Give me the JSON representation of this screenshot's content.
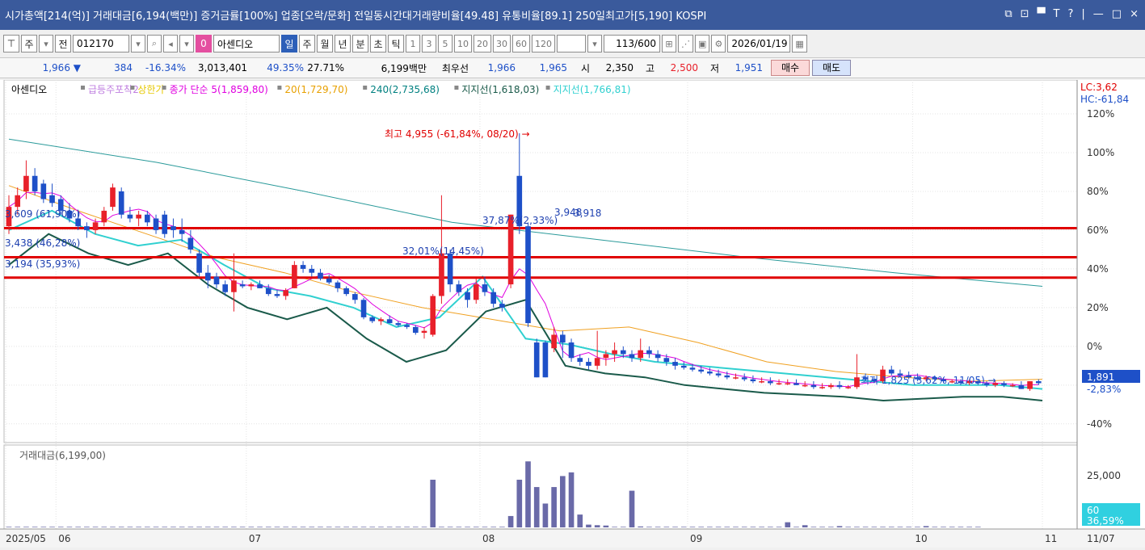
{
  "titlebar": {
    "text": "시가총액[214(억)] 거래대금[6,194(백만)] 증거금률[100%] 업종[오락/문화] 전일동시간대거래량비율[49.48] 유통비율[89.1] 250일최고가[5,190] KOSPI",
    "controls": [
      "⧉",
      "⊡",
      "▀",
      "T",
      "?",
      "|",
      "—",
      "□",
      "×"
    ]
  },
  "toolbar": {
    "first_btn": "⊤",
    "ju_btn": "주",
    "jeon_btn": "전",
    "code": "012170",
    "zero_btn": "0",
    "stock_name": "아센디오",
    "periods": [
      "일",
      "주",
      "월",
      "년",
      "분",
      "초",
      "틱"
    ],
    "active_period": "일",
    "intervals": [
      "1",
      "3",
      "5",
      "10",
      "20",
      "30",
      "60",
      "120"
    ],
    "count": "113",
    "count_total": "/600",
    "date": "2026/01/19"
  },
  "quote": {
    "price": "1,966 ▼",
    "change": "384",
    "change_pct": "-16.34%",
    "volume": "3,013,401",
    "vol_ratio": "49.35%",
    "turnover": "27.71%",
    "amount": "6,199백만",
    "best_ask_label": "최우선",
    "ask": "1,966",
    "bid": "1,965",
    "open_label": "시",
    "open": "2,350",
    "high_label": "고",
    "high": "2,500",
    "low_label": "저",
    "low": "1,951",
    "buy_label": "매수",
    "sell_label": "매도"
  },
  "legend": {
    "stock": "아센디오",
    "items": [
      {
        "text": "급등주포착2",
        "color": "#c080e0"
      },
      {
        "text": "상한가",
        "color": "#e6c800"
      },
      {
        "text": "종가 단순 5(1,859,80)",
        "color": "#e000e0"
      },
      {
        "text": "20(1,729,70)",
        "color": "#e8a000"
      },
      {
        "text": "240(2,735,68)",
        "color": "#008080"
      },
      {
        "text": "지지선(1,618,03)",
        "color": "#1a5a4a"
      },
      {
        "text": "지지선(1,766,81)",
        "color": "#30d0d0"
      }
    ]
  },
  "price_axis": {
    "lc": "LC:3,62",
    "hc": "HC:-61,84",
    "current_price": "1,891",
    "current_pct": "-2,83%"
  },
  "annotations": {
    "high_marker": "최고 4,955 (-61,84%, 08/20) →",
    "low_marker": "최저 1,825 (3,62%, 11/05) →",
    "level1": "3,609 (61,90%)",
    "level2": "3,438 (46,28%)",
    "level3": "3,194 (35,93%)",
    "trend1": "32,01%(14,45%)",
    "trend2": "37,87%(2,33%)",
    "trend3": "3,948",
    "trend4": "3,918"
  },
  "volume_panel": {
    "title": "거래대금(6,199,00)",
    "axis_label": "25,000",
    "badge_value": "60",
    "badge_pct": "36,59%"
  },
  "colors": {
    "up": "#e8202a",
    "down": "#1e50c8",
    "resistance": "#e00000",
    "title_bg": "#3a5a9c"
  },
  "chart_data": [
    {
      "type": "candlestick",
      "x_ticks": [
        "2025/05",
        "06",
        "07",
        "08",
        "09",
        "10",
        "11",
        "11/07"
      ],
      "y_ticks_pct": [
        120,
        100,
        80,
        60,
        40,
        20,
        0,
        -20,
        -40
      ],
      "y_tick_labels": [
        "120%",
        "100%",
        "80%",
        "60%",
        "40%",
        "20%",
        "0%",
        "",
        "-40%"
      ],
      "ylim_pct": [
        -48,
        125
      ],
      "candles": [
        {
          "o": 62,
          "h": 78,
          "l": 58,
          "c": 72
        },
        {
          "o": 72,
          "h": 82,
          "l": 68,
          "c": 78
        },
        {
          "o": 80,
          "h": 96,
          "l": 76,
          "c": 88
        },
        {
          "o": 88,
          "h": 92,
          "l": 78,
          "c": 80
        },
        {
          "o": 84,
          "h": 86,
          "l": 74,
          "c": 76
        },
        {
          "o": 78,
          "h": 84,
          "l": 72,
          "c": 74
        },
        {
          "o": 76,
          "h": 78,
          "l": 68,
          "c": 70
        },
        {
          "o": 70,
          "h": 74,
          "l": 64,
          "c": 66
        },
        {
          "o": 66,
          "h": 70,
          "l": 60,
          "c": 62
        },
        {
          "o": 62,
          "h": 64,
          "l": 56,
          "c": 60
        },
        {
          "o": 60,
          "h": 66,
          "l": 58,
          "c": 64
        },
        {
          "o": 64,
          "h": 72,
          "l": 62,
          "c": 70
        },
        {
          "o": 72,
          "h": 84,
          "l": 70,
          "c": 82
        },
        {
          "o": 80,
          "h": 82,
          "l": 66,
          "c": 68
        },
        {
          "o": 68,
          "h": 72,
          "l": 64,
          "c": 66
        },
        {
          "o": 66,
          "h": 70,
          "l": 62,
          "c": 68
        },
        {
          "o": 68,
          "h": 70,
          "l": 62,
          "c": 64
        },
        {
          "o": 66,
          "h": 68,
          "l": 58,
          "c": 60
        },
        {
          "o": 68,
          "h": 70,
          "l": 56,
          "c": 58
        },
        {
          "o": 62,
          "h": 66,
          "l": 56,
          "c": 60
        },
        {
          "o": 60,
          "h": 66,
          "l": 54,
          "c": 58
        },
        {
          "o": 56,
          "h": 60,
          "l": 48,
          "c": 50
        },
        {
          "o": 48,
          "h": 50,
          "l": 36,
          "c": 38
        },
        {
          "o": 38,
          "h": 42,
          "l": 30,
          "c": 34
        },
        {
          "o": 36,
          "h": 38,
          "l": 30,
          "c": 32
        },
        {
          "o": 32,
          "h": 34,
          "l": 26,
          "c": 28
        },
        {
          "o": 28,
          "h": 48,
          "l": 18,
          "c": 34
        },
        {
          "o": 32,
          "h": 34,
          "l": 30,
          "c": 31
        },
        {
          "o": 31,
          "h": 33,
          "l": 29,
          "c": 32
        },
        {
          "o": 32,
          "h": 34,
          "l": 30,
          "c": 30
        },
        {
          "o": 30,
          "h": 32,
          "l": 26,
          "c": 27
        },
        {
          "o": 27,
          "h": 29,
          "l": 25,
          "c": 26
        },
        {
          "o": 26,
          "h": 30,
          "l": 24,
          "c": 29
        },
        {
          "o": 30,
          "h": 44,
          "l": 30,
          "c": 42
        },
        {
          "o": 42,
          "h": 44,
          "l": 38,
          "c": 40
        },
        {
          "o": 40,
          "h": 42,
          "l": 36,
          "c": 38
        },
        {
          "o": 38,
          "h": 40,
          "l": 34,
          "c": 35
        },
        {
          "o": 35,
          "h": 37,
          "l": 32,
          "c": 33
        },
        {
          "o": 33,
          "h": 34,
          "l": 28,
          "c": 30
        },
        {
          "o": 30,
          "h": 31,
          "l": 26,
          "c": 27
        },
        {
          "o": 27,
          "h": 28,
          "l": 22,
          "c": 24
        },
        {
          "o": 24,
          "h": 25,
          "l": 14,
          "c": 15
        },
        {
          "o": 15,
          "h": 16,
          "l": 12,
          "c": 13
        },
        {
          "o": 13,
          "h": 15,
          "l": 11,
          "c": 14
        },
        {
          "o": 14,
          "h": 16,
          "l": 12,
          "c": 12
        },
        {
          "o": 12,
          "h": 13,
          "l": 10,
          "c": 11
        },
        {
          "o": 11,
          "h": 12,
          "l": 9,
          "c": 10
        },
        {
          "o": 10,
          "h": 11,
          "l": 6,
          "c": 7
        },
        {
          "o": 7,
          "h": 10,
          "l": 4,
          "c": 8
        },
        {
          "o": 6,
          "h": 27,
          "l": 5,
          "c": 26
        },
        {
          "o": 26,
          "h": 78,
          "l": 22,
          "c": 48
        },
        {
          "o": 48,
          "h": 50,
          "l": 28,
          "c": 32
        },
        {
          "o": 32,
          "h": 34,
          "l": 26,
          "c": 28
        },
        {
          "o": 28,
          "h": 30,
          "l": 20,
          "c": 24
        },
        {
          "o": 24,
          "h": 35,
          "l": 22,
          "c": 32
        },
        {
          "o": 32,
          "h": 36,
          "l": 26,
          "c": 28
        },
        {
          "o": 28,
          "h": 30,
          "l": 20,
          "c": 22
        },
        {
          "o": 22,
          "h": 24,
          "l": 18,
          "c": 20
        },
        {
          "o": 32,
          "h": 68,
          "l": 30,
          "c": 68
        },
        {
          "o": 88,
          "h": 110,
          "l": 58,
          "c": 62
        },
        {
          "o": 62,
          "h": 64,
          "l": 10,
          "c": 12
        },
        {
          "o": 2,
          "h": 4,
          "l": -16,
          "c": -16
        },
        {
          "o": 2,
          "h": 3,
          "l": -16,
          "c": -16
        },
        {
          "o": -1,
          "h": 10,
          "l": -3,
          "c": 6
        },
        {
          "o": 6,
          "h": 8,
          "l": -6,
          "c": 2
        },
        {
          "o": 2,
          "h": 4,
          "l": -8,
          "c": -6
        },
        {
          "o": -6,
          "h": -4,
          "l": -10,
          "c": -8
        },
        {
          "o": -8,
          "h": -6,
          "l": -12,
          "c": -10
        },
        {
          "o": -10,
          "h": 8,
          "l": -12,
          "c": -6
        },
        {
          "o": -6,
          "h": -2,
          "l": -10,
          "c": -4
        },
        {
          "o": -4,
          "h": 2,
          "l": -8,
          "c": -2
        },
        {
          "o": -2,
          "h": 0,
          "l": -6,
          "c": -4
        },
        {
          "o": -4,
          "h": -2,
          "l": -8,
          "c": -6
        },
        {
          "o": -6,
          "h": 4,
          "l": -8,
          "c": -2
        },
        {
          "o": -2,
          "h": 0,
          "l": -6,
          "c": -4
        },
        {
          "o": -4,
          "h": -2,
          "l": -8,
          "c": -6
        },
        {
          "o": -6,
          "h": -4,
          "l": -10,
          "c": -8
        },
        {
          "o": -8,
          "h": -6,
          "l": -12,
          "c": -10
        },
        {
          "o": -10,
          "h": -8,
          "l": -12,
          "c": -11
        },
        {
          "o": -11,
          "h": -9,
          "l": -13,
          "c": -12
        },
        {
          "o": -12,
          "h": -10,
          "l": -14,
          "c": -13
        },
        {
          "o": -13,
          "h": -11,
          "l": -15,
          "c": -14
        },
        {
          "o": -14,
          "h": -12,
          "l": -16,
          "c": -15
        },
        {
          "o": -15,
          "h": -13,
          "l": -17,
          "c": -16
        },
        {
          "o": -16,
          "h": -14,
          "l": -17,
          "c": -16
        },
        {
          "o": -16,
          "h": -14,
          "l": -18,
          "c": -17
        },
        {
          "o": -17,
          "h": -15,
          "l": -19,
          "c": -18
        },
        {
          "o": -18,
          "h": -16,
          "l": -19,
          "c": -18
        },
        {
          "o": -18,
          "h": -16,
          "l": -20,
          "c": -19
        },
        {
          "o": -19,
          "h": -17,
          "l": -20,
          "c": -19
        },
        {
          "o": -19,
          "h": -17,
          "l": -20,
          "c": -19
        },
        {
          "o": -19,
          "h": -17,
          "l": -20,
          "c": -20
        },
        {
          "o": -20,
          "h": -18,
          "l": -21,
          "c": -20
        },
        {
          "o": -20,
          "h": -18,
          "l": -22,
          "c": -21
        },
        {
          "o": -21,
          "h": -19,
          "l": -22,
          "c": -21
        },
        {
          "o": -21,
          "h": -19,
          "l": -22,
          "c": -20
        },
        {
          "o": -20,
          "h": -18,
          "l": -22,
          "c": -21
        },
        {
          "o": -21,
          "h": -20,
          "l": -22,
          "c": -21
        },
        {
          "o": -21,
          "h": -4,
          "l": -22,
          "c": -16
        },
        {
          "o": -16,
          "h": -14,
          "l": -18,
          "c": -17
        },
        {
          "o": -17,
          "h": -16,
          "l": -19,
          "c": -18
        },
        {
          "o": -18,
          "h": -10,
          "l": -19,
          "c": -12
        },
        {
          "o": -12,
          "h": -10,
          "l": -15,
          "c": -14
        },
        {
          "o": -14,
          "h": -12,
          "l": -16,
          "c": -15
        },
        {
          "o": -15,
          "h": -13,
          "l": -17,
          "c": -16
        },
        {
          "o": -16,
          "h": -14,
          "l": -18,
          "c": -17
        },
        {
          "o": -17,
          "h": -15,
          "l": -18,
          "c": -16
        },
        {
          "o": -16,
          "h": -15,
          "l": -18,
          "c": -17
        },
        {
          "o": -17,
          "h": -16,
          "l": -19,
          "c": -18
        },
        {
          "o": -18,
          "h": -17,
          "l": -19,
          "c": -18
        },
        {
          "o": -18,
          "h": -17,
          "l": -20,
          "c": -19
        },
        {
          "o": -19,
          "h": -17,
          "l": -20,
          "c": -18
        },
        {
          "o": -18,
          "h": -17,
          "l": -20,
          "c": -19
        },
        {
          "o": -19,
          "h": -18,
          "l": -21,
          "c": -20
        },
        {
          "o": -20,
          "h": -18,
          "l": -21,
          "c": -19
        },
        {
          "o": -19,
          "h": -18,
          "l": -21,
          "c": -20
        },
        {
          "o": -20,
          "h": -19,
          "l": -21,
          "c": -20
        },
        {
          "o": -20,
          "h": -18,
          "l": -22,
          "c": -22
        },
        {
          "o": -22,
          "h": -18,
          "l": -23,
          "c": -18
        },
        {
          "o": -18,
          "h": -17,
          "l": -20,
          "c": -19
        }
      ],
      "resistance_pct": [
        61,
        46,
        35.5
      ],
      "ma240_pct": [
        107,
        95,
        80,
        64,
        55,
        46,
        38,
        31
      ],
      "ma20_pct": [
        83,
        70,
        58,
        46,
        38,
        28,
        20,
        14,
        8,
        10,
        2,
        -8,
        -13,
        -16,
        -18,
        -17
      ],
      "support1_pct": [
        42,
        58,
        48,
        42,
        48,
        32,
        20,
        14,
        20,
        4,
        -8,
        -2,
        18,
        24,
        -10,
        -14,
        -16,
        -20,
        -22,
        -24,
        -25,
        -26,
        -28,
        -27,
        -26,
        -26,
        -28
      ],
      "support2_pct": [
        60,
        70,
        58,
        52,
        55,
        42,
        30,
        26,
        20,
        10,
        15,
        36,
        4,
        1,
        -4,
        -8,
        -10,
        -12,
        -14,
        -16,
        -18,
        -20,
        -20,
        -20,
        -22
      ]
    },
    {
      "type": "bar",
      "title": "거래대금(6,199,00)",
      "y_ticks": [
        25000
      ],
      "values": [
        300,
        300,
        300,
        300,
        300,
        300,
        300,
        300,
        300,
        300,
        300,
        300,
        300,
        300,
        300,
        300,
        300,
        300,
        300,
        300,
        300,
        300,
        300,
        300,
        300,
        300,
        300,
        300,
        300,
        300,
        300,
        300,
        300,
        300,
        300,
        300,
        300,
        300,
        300,
        300,
        300,
        300,
        300,
        300,
        300,
        300,
        300,
        300,
        300,
        300,
        300,
        300,
        300,
        300,
        300,
        300,
        300,
        300,
        300,
        300,
        300,
        300,
        300,
        300,
        300,
        300,
        300,
        300,
        300,
        300,
        300,
        300,
        300,
        300,
        300,
        300,
        300,
        300,
        300,
        300,
        300,
        300,
        300,
        300,
        300,
        300,
        300,
        300,
        300,
        300,
        300,
        300,
        300,
        300,
        300,
        300,
        300,
        300,
        300,
        300,
        300,
        300,
        300,
        300,
        300,
        300,
        300,
        300,
        300,
        300,
        300,
        300,
        300
      ],
      "spikes": {
        "49": 26000,
        "58": 6200,
        "59": 26000,
        "60": 36000,
        "61": 22000,
        "62": 13000,
        "63": 22000,
        "64": 28000,
        "65": 30000,
        "66": 7000,
        "67": 1500,
        "68": 1200,
        "69": 1000,
        "72": 20000,
        "73": 500,
        "90": 2800,
        "92": 1200,
        "96": 700,
        "106": 700
      }
    }
  ]
}
